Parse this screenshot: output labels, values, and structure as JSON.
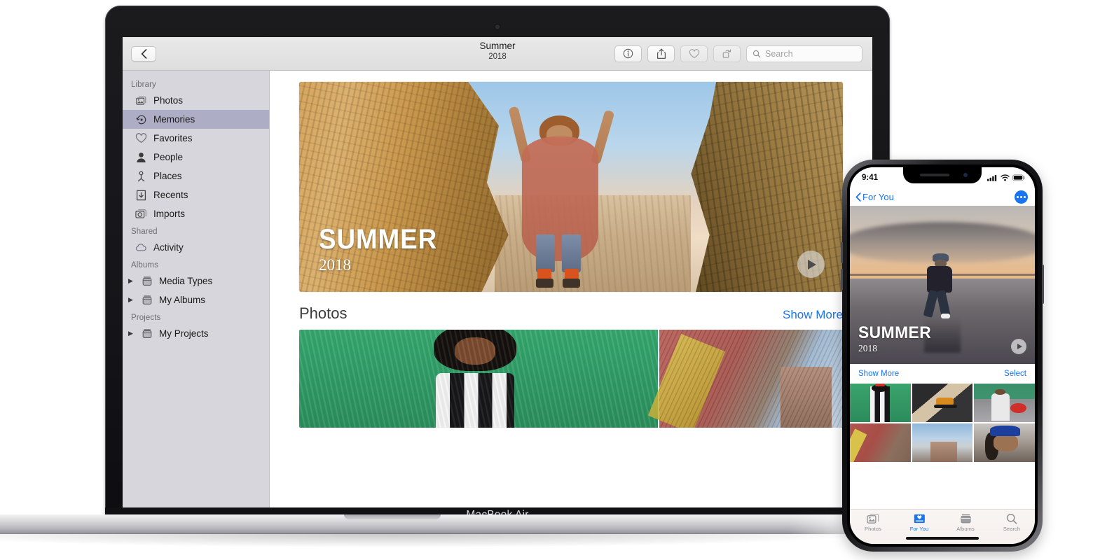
{
  "mac": {
    "device_label": "MacBook Air",
    "toolbar": {
      "back_icon": "chevron-left-icon",
      "title": "Summer",
      "subtitle": "2018",
      "buttons": [
        {
          "name": "info-button",
          "icon": "info-circle-icon"
        },
        {
          "name": "share-button",
          "icon": "share-up-arrow-icon"
        },
        {
          "name": "favorite-button",
          "icon": "heart-icon"
        },
        {
          "name": "rotate-button",
          "icon": "rotate-icon"
        }
      ],
      "search": {
        "placeholder": "Search",
        "icon": "search-icon"
      }
    },
    "sidebar": {
      "groups": [
        {
          "label": "Library",
          "items": [
            {
              "label": "Photos",
              "icon": "photos-icon",
              "selected": false,
              "disclosure": false
            },
            {
              "label": "Memories",
              "icon": "memories-icon",
              "selected": true,
              "disclosure": false
            },
            {
              "label": "Favorites",
              "icon": "heart-icon",
              "selected": false,
              "disclosure": false
            },
            {
              "label": "People",
              "icon": "person-icon",
              "selected": false,
              "disclosure": false
            },
            {
              "label": "Places",
              "icon": "pin-icon",
              "selected": false,
              "disclosure": false
            },
            {
              "label": "Recents",
              "icon": "download-box-icon",
              "selected": false,
              "disclosure": false
            },
            {
              "label": "Imports",
              "icon": "camera-import-icon",
              "selected": false,
              "disclosure": false
            }
          ]
        },
        {
          "label": "Shared",
          "items": [
            {
              "label": "Activity",
              "icon": "cloud-icon",
              "selected": false,
              "disclosure": false
            }
          ]
        },
        {
          "label": "Albums",
          "items": [
            {
              "label": "Media Types",
              "icon": "album-icon",
              "selected": false,
              "disclosure": true
            },
            {
              "label": "My Albums",
              "icon": "album-icon",
              "selected": false,
              "disclosure": true
            }
          ]
        },
        {
          "label": "Projects",
          "items": [
            {
              "label": "My Projects",
              "icon": "album-icon",
              "selected": false,
              "disclosure": true
            }
          ]
        }
      ]
    },
    "hero": {
      "title": "SUMMER",
      "year": "2018",
      "play_icon": "play-icon",
      "alt": "woman in sheer coral dress between tall sandstone rocks on a beach"
    },
    "section": {
      "heading": "Photos",
      "show_more": "Show More"
    },
    "thumbs": [
      {
        "name": "photo-green-wall",
        "alt": "woman in black and white striped dress against green wall"
      },
      {
        "name": "photo-brick-buildings",
        "alt": "red brick building with yellow stripes and city towers"
      }
    ]
  },
  "iphone": {
    "status": {
      "time": "9:41",
      "cellular_icon": "signal-bars-icon",
      "wifi_icon": "wifi-icon",
      "battery_icon": "battery-icon"
    },
    "nav": {
      "back_label": "For You",
      "back_icon": "chevron-left-icon",
      "more_icon": "ellipsis-circle-icon"
    },
    "hero": {
      "title": "SUMMER",
      "year": "2018",
      "play_icon": "play-icon",
      "alt": "person walking on wet sand at sunset with birds"
    },
    "actions": {
      "show_more": "Show More",
      "select": "Select"
    },
    "grid": [
      {
        "name": "thumb-striped-dress-green",
        "alt": "person in striped dress against green wall"
      },
      {
        "name": "thumb-skateboarder",
        "alt": "skateboarder on asphalt road"
      },
      {
        "name": "thumb-red-hat",
        "alt": "man holding a red hat"
      },
      {
        "name": "thumb-brick-wall",
        "alt": "red brick wall with yellow stripes"
      },
      {
        "name": "thumb-tower-sky",
        "alt": "building tower against cloudy sky"
      },
      {
        "name": "thumb-blue-cap-portrait",
        "alt": "portrait of person in blue cap"
      }
    ],
    "tabs": [
      {
        "label": "Photos",
        "icon": "photos-icon",
        "active": false
      },
      {
        "label": "For You",
        "icon": "for-you-icon",
        "active": true
      },
      {
        "label": "Albums",
        "icon": "albums-icon",
        "active": false
      },
      {
        "label": "Search",
        "icon": "search-icon",
        "active": false
      }
    ]
  },
  "colors": {
    "accent_blue": "#1874f0",
    "sidebar_bg": "#d6d6dc",
    "sidebar_selected": "#adadc6",
    "toolbar_bg": "#e4e4e4"
  }
}
